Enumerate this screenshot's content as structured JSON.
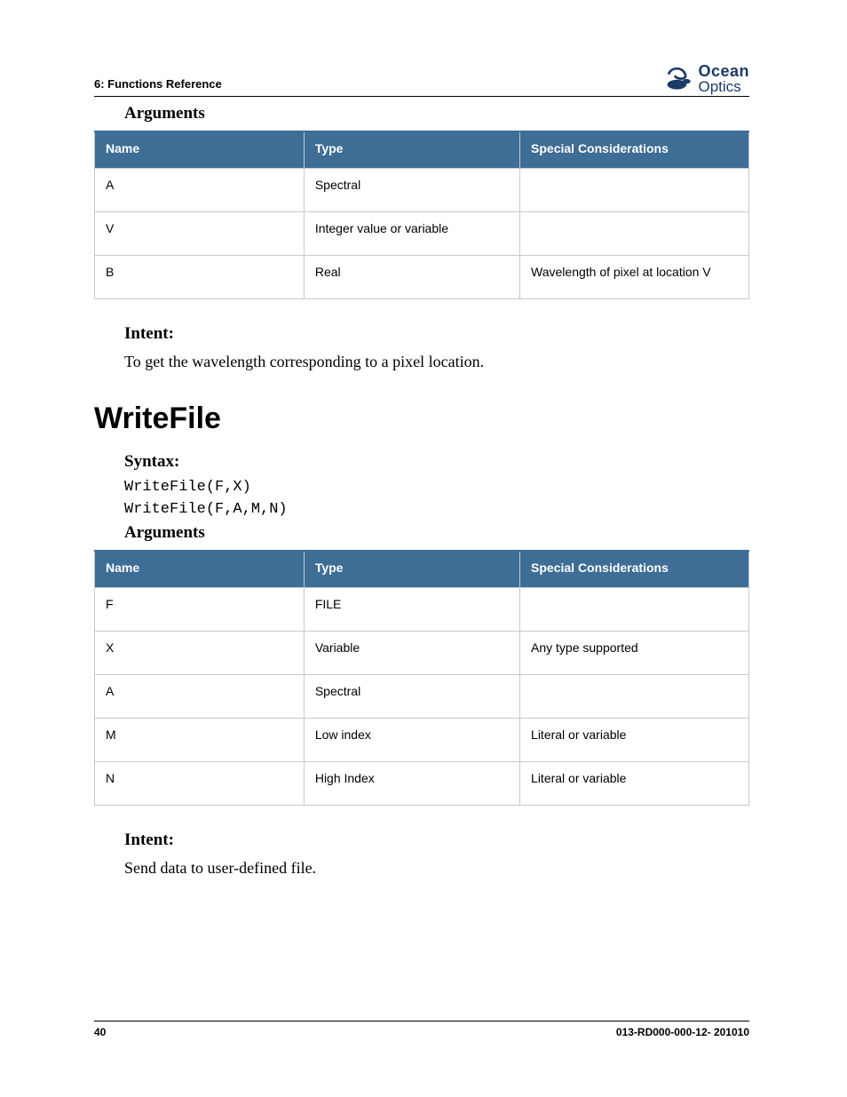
{
  "header": {
    "section": "6: Functions Reference",
    "logo_top": "Ocean",
    "logo_bottom": "Optics"
  },
  "sec1": {
    "arguments_heading": "Arguments",
    "table": {
      "headers": [
        "Name",
        "Type",
        "Special Considerations"
      ],
      "rows": [
        {
          "name": "A",
          "type": "Spectral",
          "special": ""
        },
        {
          "name": "V",
          "type": "Integer value or variable",
          "special": ""
        },
        {
          "name": "B",
          "type": "Real",
          "special": "Wavelength of pixel at location V"
        }
      ]
    },
    "intent_label": "Intent:",
    "intent_body": "To get the wavelength corresponding to a pixel location."
  },
  "sec2": {
    "title": "WriteFile",
    "syntax_label": "Syntax:",
    "syntax_lines": [
      "WriteFile(F,X)",
      "WriteFile(F,A,M,N)"
    ],
    "arguments_heading": "Arguments",
    "table": {
      "headers": [
        "Name",
        "Type",
        "Special Considerations"
      ],
      "rows": [
        {
          "name": "F",
          "type": "FILE",
          "special": ""
        },
        {
          "name": "X",
          "type": "Variable",
          "special": "Any type supported"
        },
        {
          "name": "A",
          "type": "Spectral",
          "special": ""
        },
        {
          "name": "M",
          "type": "Low index",
          "special": "Literal or variable"
        },
        {
          "name": "N",
          "type": "High Index",
          "special": "Literal or variable"
        }
      ]
    },
    "intent_label": "Intent:",
    "intent_body": "Send data to user-defined file."
  },
  "footer": {
    "page": "40",
    "docid": "013-RD000-000-12- 201010"
  }
}
